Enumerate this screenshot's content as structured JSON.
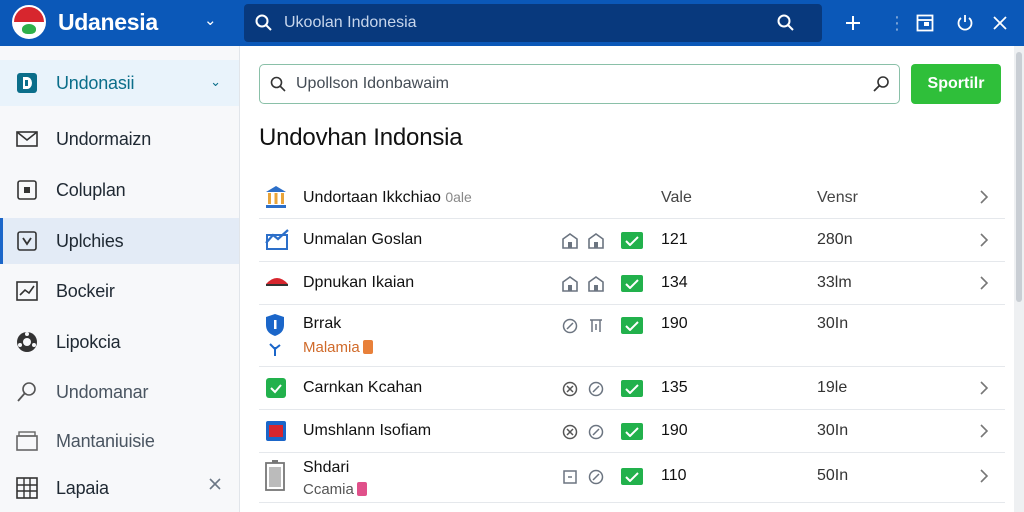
{
  "app": {
    "title": "Udanesia",
    "search_text": "Ukoolan Indonesia"
  },
  "sidebar": {
    "items": [
      {
        "label": "Undonasii",
        "icon": "d-logo-icon"
      },
      {
        "label": "Undormaizn",
        "icon": "mail-icon"
      },
      {
        "label": "Coluplan",
        "icon": "panel-icon"
      },
      {
        "label": "Uplchies",
        "icon": "chevron-box-icon"
      },
      {
        "label": "Bockeir",
        "icon": "chart-icon"
      },
      {
        "label": "Lipokcia",
        "icon": "settings-icon"
      },
      {
        "label": "Undomanar",
        "icon": "search-icon"
      },
      {
        "label": "Mantaniuisie",
        "icon": "folder-icon"
      },
      {
        "label": "Lapaia",
        "icon": "grid-icon"
      }
    ]
  },
  "main": {
    "search_placeholder": "Upollson Idonbawaim",
    "search_button": "Sportilr",
    "title": "Undovhan Indonsia",
    "header": {
      "name": "Undortaan Ikkchiao",
      "name_dim": "0ale",
      "value": "Vale",
      "version": "Vensr"
    },
    "rows": [
      {
        "name": "Unmalan Goslan",
        "value": "121",
        "version": "280n",
        "icon": "chart-box-icon",
        "acts": [
          "house-icon",
          "house-icon"
        ]
      },
      {
        "name": "Dpnukan Ikaian",
        "value": "134",
        "version": "33lm",
        "icon": "cap-icon",
        "acts": [
          "house-icon",
          "house-icon"
        ]
      },
      {
        "name": "Brrak",
        "sub": "Malamia",
        "value": "190",
        "version": "30In",
        "icon": "shield-icon",
        "acts": [
          "circle-slash-icon",
          "box-icon"
        ]
      },
      {
        "name": "Carnkan Kcahan",
        "value": "135",
        "version": "19le",
        "icon": "green-box-icon",
        "acts": [
          "x-circle-icon",
          "circle-slash-icon"
        ]
      },
      {
        "name": "Umshlann Isofiam",
        "value": "190",
        "version": "30In",
        "icon": "red-box-icon",
        "acts": [
          "x-circle-icon",
          "circle-slash-icon"
        ]
      },
      {
        "name": "Shdari",
        "sub": "Ccamia",
        "value": "110",
        "version": "50In",
        "icon": "battery-icon",
        "acts": [
          "box-icon",
          "circle-slash-icon"
        ]
      }
    ]
  }
}
